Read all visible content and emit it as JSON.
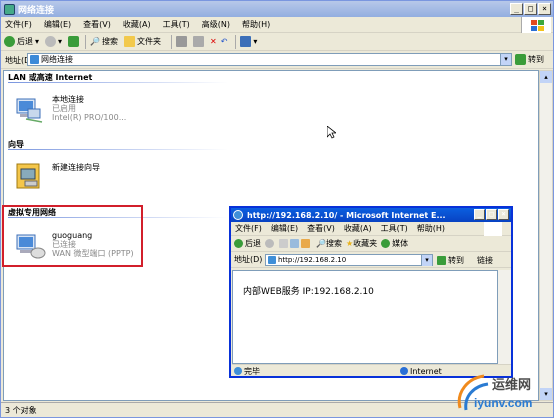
{
  "explorer": {
    "title": "网络连接",
    "menu": [
      "文件(F)",
      "编辑(E)",
      "查看(V)",
      "收藏(A)",
      "工具(T)",
      "高级(N)",
      "帮助(H)"
    ],
    "toolbar": {
      "back": "后退",
      "search": "搜索",
      "folders": "文件夹"
    },
    "address_label": "地址(D)",
    "address_value": "网络连接",
    "go_label": "转到",
    "groups": {
      "lan": "LAN 或高速 Internet",
      "wizard": "向导",
      "vpn": "虚拟专用网络"
    },
    "items": {
      "local": {
        "name": "本地连接",
        "status": "已启用",
        "device": "Intel(R) PRO/100..."
      },
      "wizard": {
        "name": "新建连接向导"
      },
      "vpn": {
        "name": "guoguang",
        "status": "已连接",
        "device": "WAN 微型端口 (PPTP)"
      }
    },
    "status": "3 个对象"
  },
  "ie": {
    "title": "http://192.168.2.10/ - Microsoft Internet E...",
    "menu": [
      "文件(F)",
      "编辑(E)",
      "查看(V)",
      "收藏(A)",
      "工具(T)",
      "帮助(H)"
    ],
    "toolbar": {
      "back": "后退",
      "search": "搜索",
      "favorites": "收藏夹",
      "media": "媒体"
    },
    "address_label": "地址(D)",
    "address_value": "http://192.168.2.10",
    "go_label": "转到",
    "links_label": "链接",
    "body_text": "内部WEB服务 IP:192.168.2.10",
    "status_left": "完毕",
    "status_zone": "Internet"
  },
  "watermark": {
    "cn": "运维网",
    "en": "iyunv.com"
  }
}
